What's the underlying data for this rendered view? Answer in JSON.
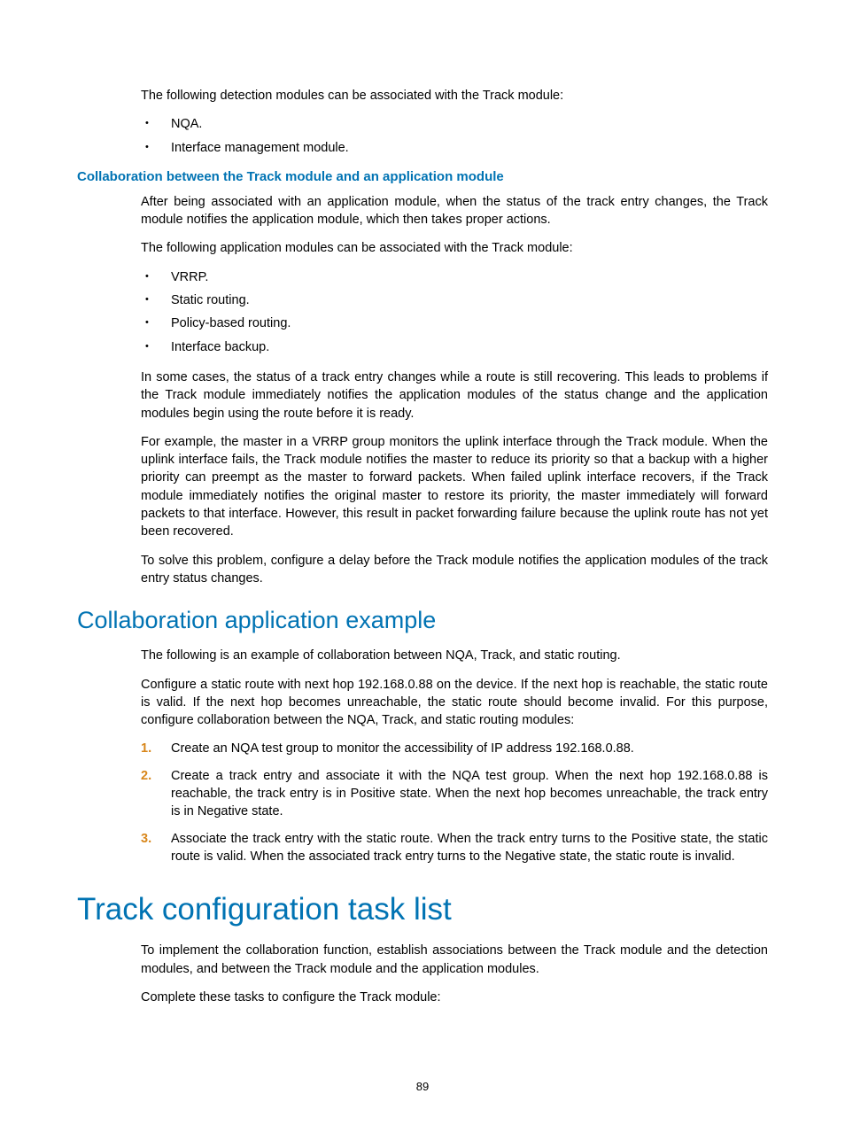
{
  "intro": {
    "p1": "The following detection modules can be associated with the Track module:",
    "bullets1": [
      "NQA.",
      "Interface management module."
    ]
  },
  "collabSection": {
    "heading": "Collaboration between the Track module and an application module",
    "p1": "After being associated with an application module, when the status of the track entry changes, the Track module notifies the application module, which then takes proper actions.",
    "p2": "The following application modules can be associated with the Track module:",
    "bullets": [
      "VRRP.",
      "Static routing.",
      "Policy-based routing.",
      "Interface backup."
    ],
    "p3": "In some cases, the status of a track entry changes while a route is still recovering. This leads to problems if the Track module immediately notifies the application modules of the status change and the application modules begin using the route before it is ready.",
    "p4": "For example, the master in a VRRP group monitors the uplink interface through the Track module. When the uplink interface fails, the Track module notifies the master to reduce its priority so that a backup with a higher priority can preempt as the master to forward packets. When failed uplink interface recovers, if the Track module immediately notifies the original master to restore its priority, the master immediately will forward packets to that interface. However, this result in packet forwarding failure because the uplink route has not yet been recovered.",
    "p5": "To solve this problem, configure a delay before the Track module notifies the application modules of the track entry status changes."
  },
  "exampleSection": {
    "heading": "Collaboration application example",
    "p1": "The following is an example of collaboration between NQA, Track, and static routing.",
    "p2": "Configure a static route with next hop 192.168.0.88 on the device. If the next hop is reachable, the static route is valid. If the next hop becomes unreachable, the static route should become invalid. For this purpose, configure collaboration between the NQA, Track, and static routing modules:",
    "steps": [
      {
        "num": "1.",
        "text": "Create an NQA test group to monitor the accessibility of IP address 192.168.0.88."
      },
      {
        "num": "2.",
        "text": "Create a track entry and associate it with the NQA test group. When the next hop 192.168.0.88 is reachable, the track entry is in Positive state. When the next hop becomes unreachable, the track entry is in Negative state."
      },
      {
        "num": "3.",
        "text": "Associate the track entry with the static route. When the track entry turns to the Positive state, the static route is valid. When the associated track entry turns to the Negative state, the static route is invalid."
      }
    ]
  },
  "taskListSection": {
    "heading": "Track configuration task list",
    "p1": "To implement the collaboration function, establish associations between the Track module and the detection modules, and between the Track module and the application modules.",
    "p2": "Complete these tasks to configure the Track module:"
  },
  "pageNumber": "89"
}
